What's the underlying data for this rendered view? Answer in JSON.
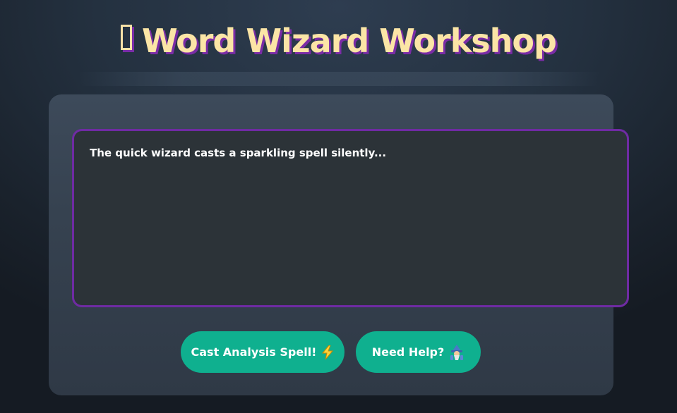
{
  "header": {
    "title": "Word Wizard Workshop",
    "title_icon": "missing-glyph-icon",
    "title_color": "#fbe5a6",
    "title_shadow_color": "#7b2ca6"
  },
  "editor": {
    "placeholder": "The quick wizard casts a sparkling spell silently...",
    "value": "",
    "border_color": "#6f2ba3",
    "background": "#2c3338"
  },
  "actions": {
    "cast_label": "Cast Analysis Spell!",
    "cast_icon": "lightning-bolt-icon",
    "help_label": "Need Help?",
    "help_icon": "wizard-icon",
    "button_color": "#0fb08f"
  }
}
